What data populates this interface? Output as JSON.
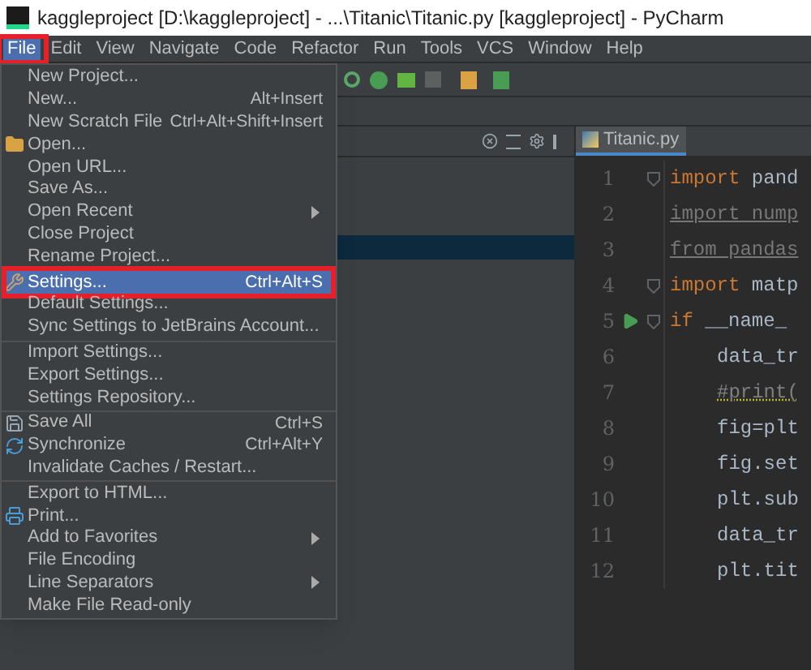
{
  "window": {
    "title": "kaggleproject [D:\\kaggleproject] - ...\\Titanic\\Titanic.py [kaggleproject] - PyCharm"
  },
  "menu_bar": [
    {
      "label": "File",
      "selected": true,
      "annotated": true
    },
    {
      "label": "Edit",
      "selected": false
    },
    {
      "label": "View",
      "selected": false
    },
    {
      "label": "Navigate",
      "selected": false
    },
    {
      "label": "Code",
      "selected": false
    },
    {
      "label": "Refactor",
      "selected": false
    },
    {
      "label": "Run",
      "selected": false
    },
    {
      "label": "Tools",
      "selected": false
    },
    {
      "label": "VCS",
      "selected": false
    },
    {
      "label": "Window",
      "selected": false
    },
    {
      "label": "Help",
      "selected": false
    }
  ],
  "file_menu": [
    [
      {
        "label": "New Project...",
        "selected": false
      },
      {
        "label": "New...",
        "shortcut": "Alt+Insert",
        "selected": false
      },
      {
        "label": "New Scratch File",
        "shortcut": "Ctrl+Alt+Shift+Insert",
        "selected": false
      },
      {
        "label": "Open...",
        "kind": "folder",
        "selected": false
      },
      {
        "label": "Open URL...",
        "selected": false
      },
      {
        "label": "Save As...",
        "selected": false
      },
      {
        "label": "Open Recent",
        "submenu": true,
        "selected": false
      },
      {
        "label": "Close Project",
        "selected": false
      },
      {
        "label": "Rename Project...",
        "selected": false
      }
    ],
    [
      {
        "label": "Settings...",
        "shortcut": "Ctrl+Alt+S",
        "kind": "wrench",
        "selected": true,
        "annotated": true
      },
      {
        "label": "Default Settings...",
        "selected": false
      },
      {
        "label": "Sync Settings to JetBrains Account...",
        "selected": false
      }
    ],
    [
      {
        "label": "Import Settings...",
        "selected": false
      },
      {
        "label": "Export Settings...",
        "selected": false
      },
      {
        "label": "Settings Repository...",
        "selected": false
      }
    ],
    [
      {
        "label": "Save All",
        "shortcut": "Ctrl+S",
        "kind": "save",
        "selected": false
      },
      {
        "label": "Synchronize",
        "shortcut": "Ctrl+Alt+Y",
        "kind": "sync",
        "selected": false
      },
      {
        "label": "Invalidate Caches / Restart...",
        "selected": false
      }
    ],
    [
      {
        "label": "Export to HTML...",
        "selected": false
      },
      {
        "label": "Print...",
        "kind": "print",
        "selected": false
      },
      {
        "label": "Add to Favorites",
        "submenu": true,
        "selected": false
      },
      {
        "label": "File Encoding",
        "selected": false
      },
      {
        "label": "Line Separators",
        "submenu": true,
        "selected": false
      },
      {
        "label": "Make File Read-only",
        "selected": false
      }
    ]
  ],
  "editor_tab": {
    "label": "Titanic.py",
    "selected": true
  },
  "code_lines": [
    {
      "number": "1",
      "fold": true,
      "tokens": [
        {
          "text": "import ",
          "kind": "keyword"
        },
        {
          "text": "pand",
          "kind": "plain"
        }
      ]
    },
    {
      "number": "2",
      "tokens": [
        {
          "text": "import nump",
          "kind": "unused"
        }
      ]
    },
    {
      "number": "3",
      "tokens": [
        {
          "text": "from pandas",
          "kind": "unused"
        }
      ]
    },
    {
      "number": "4",
      "fold": true,
      "tokens": [
        {
          "text": "import ",
          "kind": "keyword"
        },
        {
          "text": "matp",
          "kind": "plain"
        }
      ]
    },
    {
      "number": "5",
      "fold": true,
      "run": true,
      "tokens": [
        {
          "text": "if ",
          "kind": "keyword"
        },
        {
          "text": "__name_",
          "kind": "plain"
        }
      ],
      "children": [
        {
          "number": "6",
          "tokens": [
            {
              "text": "data_tr",
              "kind": "plain"
            }
          ]
        },
        {
          "number": "7",
          "tokens": [
            {
              "text": "#print(",
              "kind": "comment"
            }
          ]
        },
        {
          "number": "8",
          "tokens": [
            {
              "text": "fig=plt",
              "kind": "plain"
            }
          ]
        },
        {
          "number": "9",
          "tokens": [
            {
              "text": "fig.set",
              "kind": "plain"
            }
          ]
        },
        {
          "number": "10",
          "tokens": [
            {
              "text": "plt.sub",
              "kind": "plain"
            }
          ]
        },
        {
          "number": "11",
          "tokens": [
            {
              "text": "data_tr",
              "kind": "plain"
            }
          ]
        },
        {
          "number": "12",
          "tokens": [
            {
              "text": "plt.tit",
              "kind": "plain"
            }
          ]
        }
      ]
    }
  ]
}
